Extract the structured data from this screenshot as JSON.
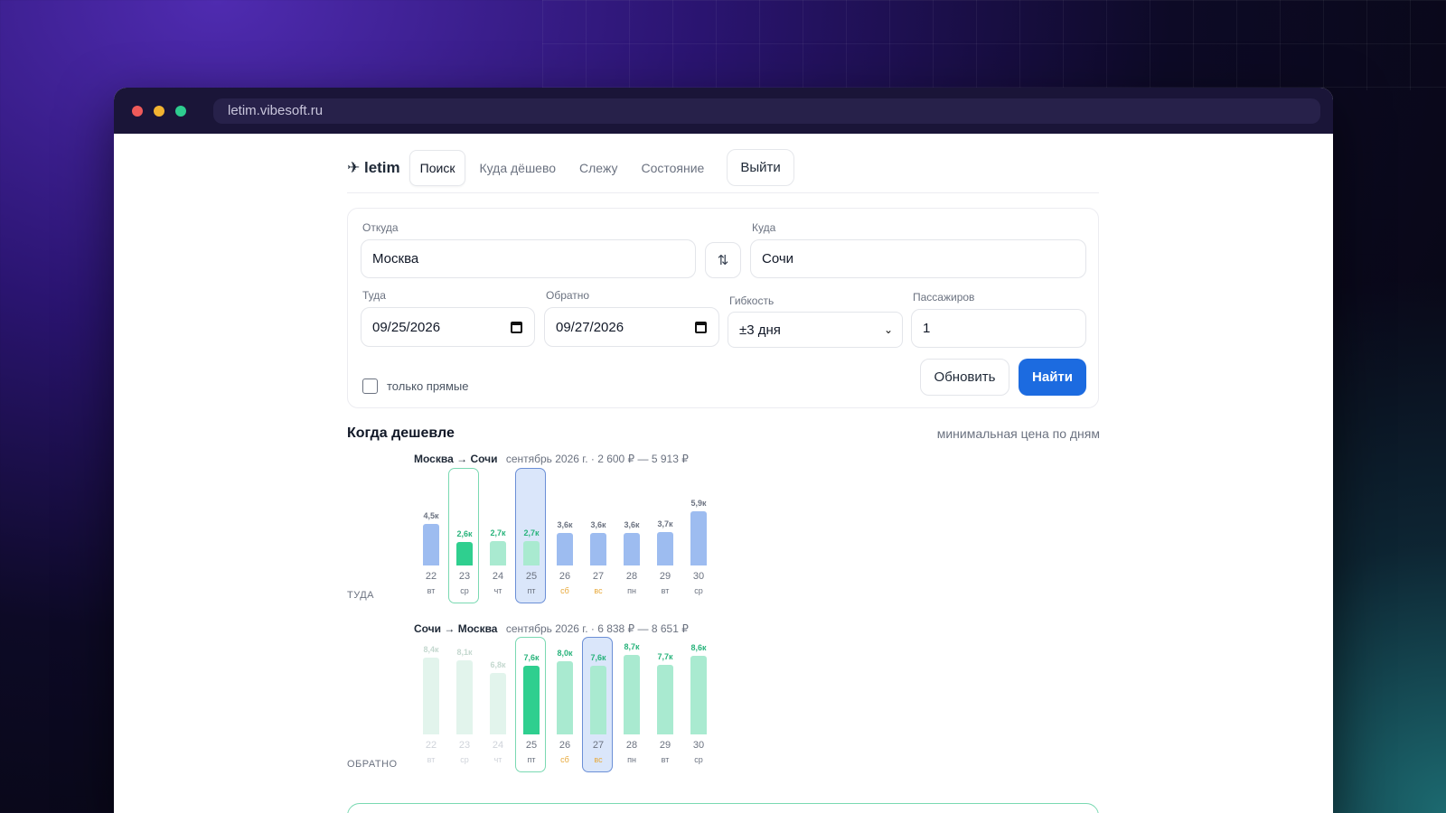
{
  "browser": {
    "url": "letim.vibesoft.ru"
  },
  "nav": {
    "logo": "✈ letim",
    "tabs": [
      "Поиск",
      "Куда дёшево",
      "Слежу",
      "Состояние"
    ],
    "logout": "Выйти"
  },
  "form": {
    "from_label": "Откуда",
    "from_value": "Москва",
    "to_label": "Куда",
    "to_value": "Сочи",
    "swap_icon": "⇅",
    "depart_label": "Туда",
    "depart_value": "09/25/2026",
    "return_label": "Обратно",
    "return_value": "09/27/2026",
    "flex_label": "Гибкость",
    "flex_value": "±3 дня",
    "pax_label": "Пассажиров",
    "pax_value": "1",
    "direct_only_label": "только прямые",
    "refresh_label": "Обновить",
    "find_label": "Найти"
  },
  "calendar": {
    "title": "Когда дешевле",
    "subtitle": "минимальная цена по дням",
    "outbound": {
      "direction_label": "ТУДА",
      "route_from": "Москва",
      "route_arrow": "→",
      "route_to": "Сочи",
      "meta": "сентябрь 2026 г. · 2 600 ₽ — 5 913 ₽",
      "days": [
        {
          "day": "22",
          "weekday": "вт",
          "price_label": "4,5к",
          "price": 4500,
          "style": "blue"
        },
        {
          "day": "23",
          "weekday": "ср",
          "price_label": "2,6к",
          "price": 2600,
          "style": "best",
          "highlight": "green"
        },
        {
          "day": "24",
          "weekday": "чт",
          "price_label": "2,7к",
          "price": 2700,
          "style": "green-light"
        },
        {
          "day": "25",
          "weekday": "пт",
          "price_label": "2,7к",
          "price": 2700,
          "style": "green-light",
          "highlight": "blue"
        },
        {
          "day": "26",
          "weekday": "сб",
          "price_label": "3,6к",
          "price": 3600,
          "style": "blue",
          "weekend": true
        },
        {
          "day": "27",
          "weekday": "вс",
          "price_label": "3,6к",
          "price": 3600,
          "style": "blue",
          "weekend": true
        },
        {
          "day": "28",
          "weekday": "пн",
          "price_label": "3,6к",
          "price": 3600,
          "style": "blue"
        },
        {
          "day": "29",
          "weekday": "вт",
          "price_label": "3,7к",
          "price": 3700,
          "style": "blue"
        },
        {
          "day": "30",
          "weekday": "ср",
          "price_label": "5,9к",
          "price": 5900,
          "style": "blue"
        }
      ]
    },
    "return": {
      "direction_label": "ОБРАТНО",
      "route_from": "Сочи",
      "route_arrow": "→",
      "route_to": "Москва",
      "meta": "сентябрь 2026 г. · 6 838 ₽ — 8 651 ₽",
      "days": [
        {
          "day": "22",
          "weekday": "вт",
          "price_label": "8,4к",
          "price": 8400,
          "style": "faded"
        },
        {
          "day": "23",
          "weekday": "ср",
          "price_label": "8,1к",
          "price": 8100,
          "style": "faded"
        },
        {
          "day": "24",
          "weekday": "чт",
          "price_label": "6,8к",
          "price": 6800,
          "style": "faded"
        },
        {
          "day": "25",
          "weekday": "пт",
          "price_label": "7,6к",
          "price": 7600,
          "style": "best",
          "highlight": "green"
        },
        {
          "day": "26",
          "weekday": "сб",
          "price_label": "8,0к",
          "price": 8000,
          "style": "green-light",
          "weekend": true
        },
        {
          "day": "27",
          "weekday": "вс",
          "price_label": "7,6к",
          "price": 7600,
          "style": "green-light",
          "highlight": "blue",
          "weekend": true
        },
        {
          "day": "28",
          "weekday": "пн",
          "price_label": "8,7к",
          "price": 8700,
          "style": "green-light"
        },
        {
          "day": "29",
          "weekday": "вт",
          "price_label": "7,7к",
          "price": 7700,
          "style": "green-light"
        },
        {
          "day": "30",
          "weekday": "ср",
          "price_label": "8,6к",
          "price": 8600,
          "style": "green-light"
        }
      ]
    }
  },
  "colors": {
    "accent": "#1c6be0",
    "bar_blue": "#9dbcf0",
    "bar_best": "#2fcf8f",
    "bar_green_light": "#a9ead0",
    "bar_faded": "#e2f4ec",
    "label_green": "#28b37b",
    "weekend": "#e8a93a"
  }
}
